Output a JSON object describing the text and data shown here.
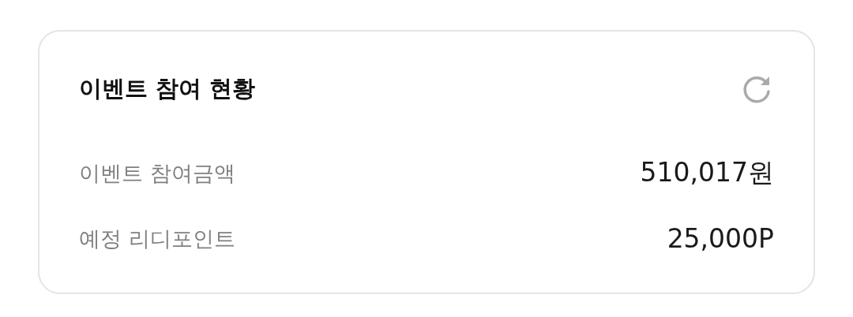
{
  "card": {
    "title": "이벤트 참여 현황",
    "rows": [
      {
        "label": "이벤트 참여금액",
        "value": "510,017원"
      },
      {
        "label": "예정 리디포인트",
        "value": "25,000P"
      }
    ]
  }
}
